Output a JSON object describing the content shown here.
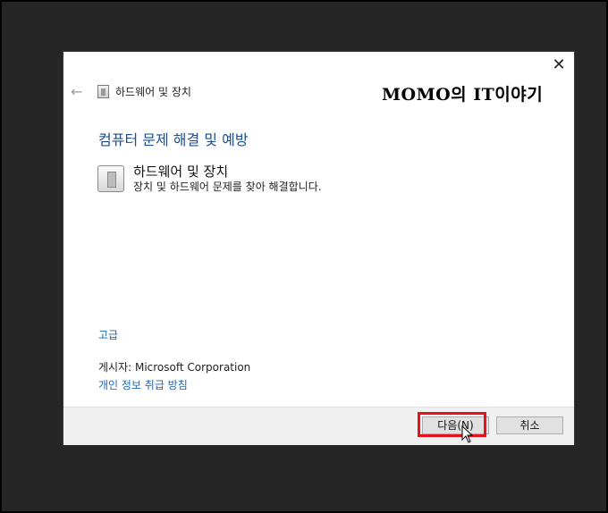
{
  "dialog": {
    "title": "하드웨어 및 장치",
    "section_title": "컴퓨터 문제 해결 및 예방",
    "item": {
      "title": "하드웨어 및 장치",
      "description": "장치 및 하드웨어 문제를 찾아 해결합니다."
    },
    "advanced_link": "고급",
    "publisher": "게시자:  Microsoft Corporation",
    "privacy_link": "개인 정보 취급 방침",
    "next_label": "다음(N)",
    "cancel_label": "취소"
  },
  "watermark": "MOMO의 IT이야기",
  "colors": {
    "accent_red": "#e8101a",
    "link_blue": "#1a66b8",
    "title_blue": "#1e4e8c"
  },
  "icons": [
    "close-icon",
    "back-arrow-icon",
    "hardware-icon",
    "mouse-cursor-icon"
  ]
}
